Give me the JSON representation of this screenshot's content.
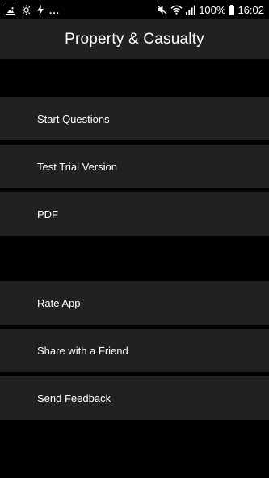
{
  "status_bar": {
    "left_icons": [
      "image-icon",
      "sun-settings-icon",
      "flash-icon"
    ],
    "overflow_dots": "...",
    "right_icons": [
      "mute-icon",
      "wifi-icon",
      "signal-icon"
    ],
    "battery_percent": "100%",
    "battery_icon": "battery-full-icon",
    "time": "16:02"
  },
  "app_bar": {
    "title": "Property & Casualty"
  },
  "menu": {
    "items": [
      {
        "label": "Start Questions"
      },
      {
        "label": "Test Trial Version"
      },
      {
        "label": "PDF"
      },
      {
        "label": "Rate App"
      },
      {
        "label": "Share with a Friend"
      },
      {
        "label": "Send Feedback"
      }
    ]
  },
  "colors": {
    "background": "#000000",
    "surface": "#212121",
    "text": "#ffffff"
  }
}
